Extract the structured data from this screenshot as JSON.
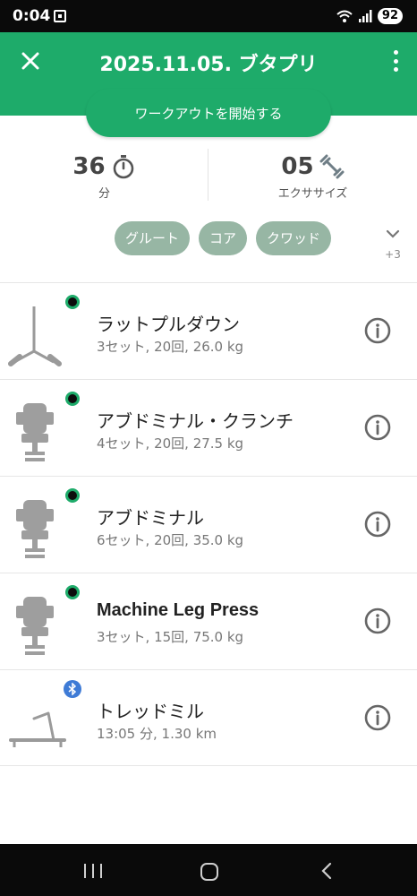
{
  "status_bar": {
    "time": "0:04",
    "battery": "92"
  },
  "header": {
    "title": "2025.11.05. ブタプリ"
  },
  "start_button": {
    "label": "ワークアウトを開始する"
  },
  "stats": {
    "duration": {
      "value": "36",
      "label": "分",
      "icon": "stopwatch-icon"
    },
    "exercises": {
      "value": "05",
      "label": "エクササイズ",
      "icon": "dumbbell-icon"
    }
  },
  "tags": {
    "items": [
      "グルート",
      "コア",
      "クワッド"
    ],
    "more": "+3"
  },
  "exercises": [
    {
      "name": "ラットプルダウン",
      "detail": "3セット, 20回, 26.0 kg",
      "icon": "lat-pulldown-icon",
      "badge": "connected-status"
    },
    {
      "name": "アブドミナル・クランチ",
      "detail": "4セット, 20回, 27.5 kg",
      "icon": "machine-seat-icon",
      "badge": "connected-status"
    },
    {
      "name": "アブドミナル",
      "detail": "6セット, 20回, 35.0 kg",
      "icon": "machine-seat-icon",
      "badge": "connected-status"
    },
    {
      "name": "Machine Leg Press",
      "detail": "3セット, 15回, 75.0 kg",
      "icon": "machine-seat-icon",
      "badge": "connected-status"
    },
    {
      "name": "トレッドミル",
      "detail": "13:05 分, 1.30 km",
      "icon": "treadmill-icon",
      "badge": "bluetooth"
    }
  ],
  "colors": {
    "brand": "#1eab6a",
    "tag": "#97b6a4",
    "bluetooth": "#3e7bd6"
  }
}
